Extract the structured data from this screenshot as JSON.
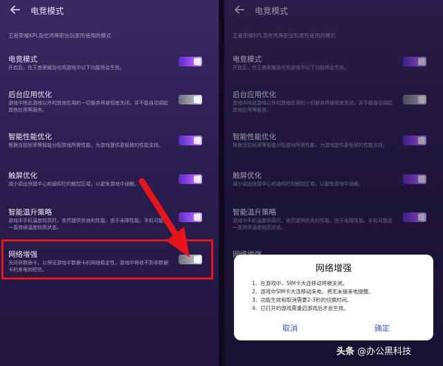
{
  "header": {
    "title": "电竞模式"
  },
  "subtitle": "王者荣耀KPL及吃鸡等职业玩家所使用的模式",
  "settings": [
    {
      "title": "电竞模式",
      "desc": "开启后，在王者荣耀及吃鸡游戏中以下功能将会生效。",
      "state": "on"
    },
    {
      "title": "后台应用优化",
      "desc": "游戏中除此游戏以外的其他应用的一切服务将被彻底关闭，并不能自动调起其他应用等服务。",
      "state": "off"
    },
    {
      "title": "智能性能优化",
      "desc": "根据当前帧率等智能分配游戏所需性能，为游戏提供更极致的性能支持。",
      "state": "on"
    },
    {
      "title": "触屏优化",
      "desc": "减小调出快捷中心和通知栏的触控区域，以避免游戏中误触。",
      "state": "on"
    },
    {
      "title": "智能温升策略",
      "desc": "游戏中手机温度较高时，依然提供优良的性能，由于未降性能，手机可能会一直持续温度较高状态。",
      "state": "on"
    },
    {
      "title": "网络增强",
      "desc": "关闭非数据卡，以保证游戏中数据卡的网络稳定性，游戏中将收不到非数据卡的来电和短信。",
      "state": "off"
    }
  ],
  "right_partial_item_title": "网络增强",
  "dialog": {
    "title": "网络增强",
    "lines": [
      "1、在游戏中，SIM卡大连移动将被关闭。",
      "2、游戏中SIM卡大连移动来电，将无未接来电提醒。",
      "3、功能生效和取消需要2-3秒的切换时间。",
      "4、已打开的游戏需重启游戏后才会生效。"
    ],
    "cancel": "取消",
    "ok": "确定"
  },
  "watermark": {
    "prefix": "头条",
    "handle": "@办公黑科技"
  },
  "colors": {
    "accent": "#9a50f0",
    "highlight": "#e8141c",
    "dialog_button": "#3b5fd0"
  },
  "icons": {
    "back": "back-arrow-icon"
  }
}
